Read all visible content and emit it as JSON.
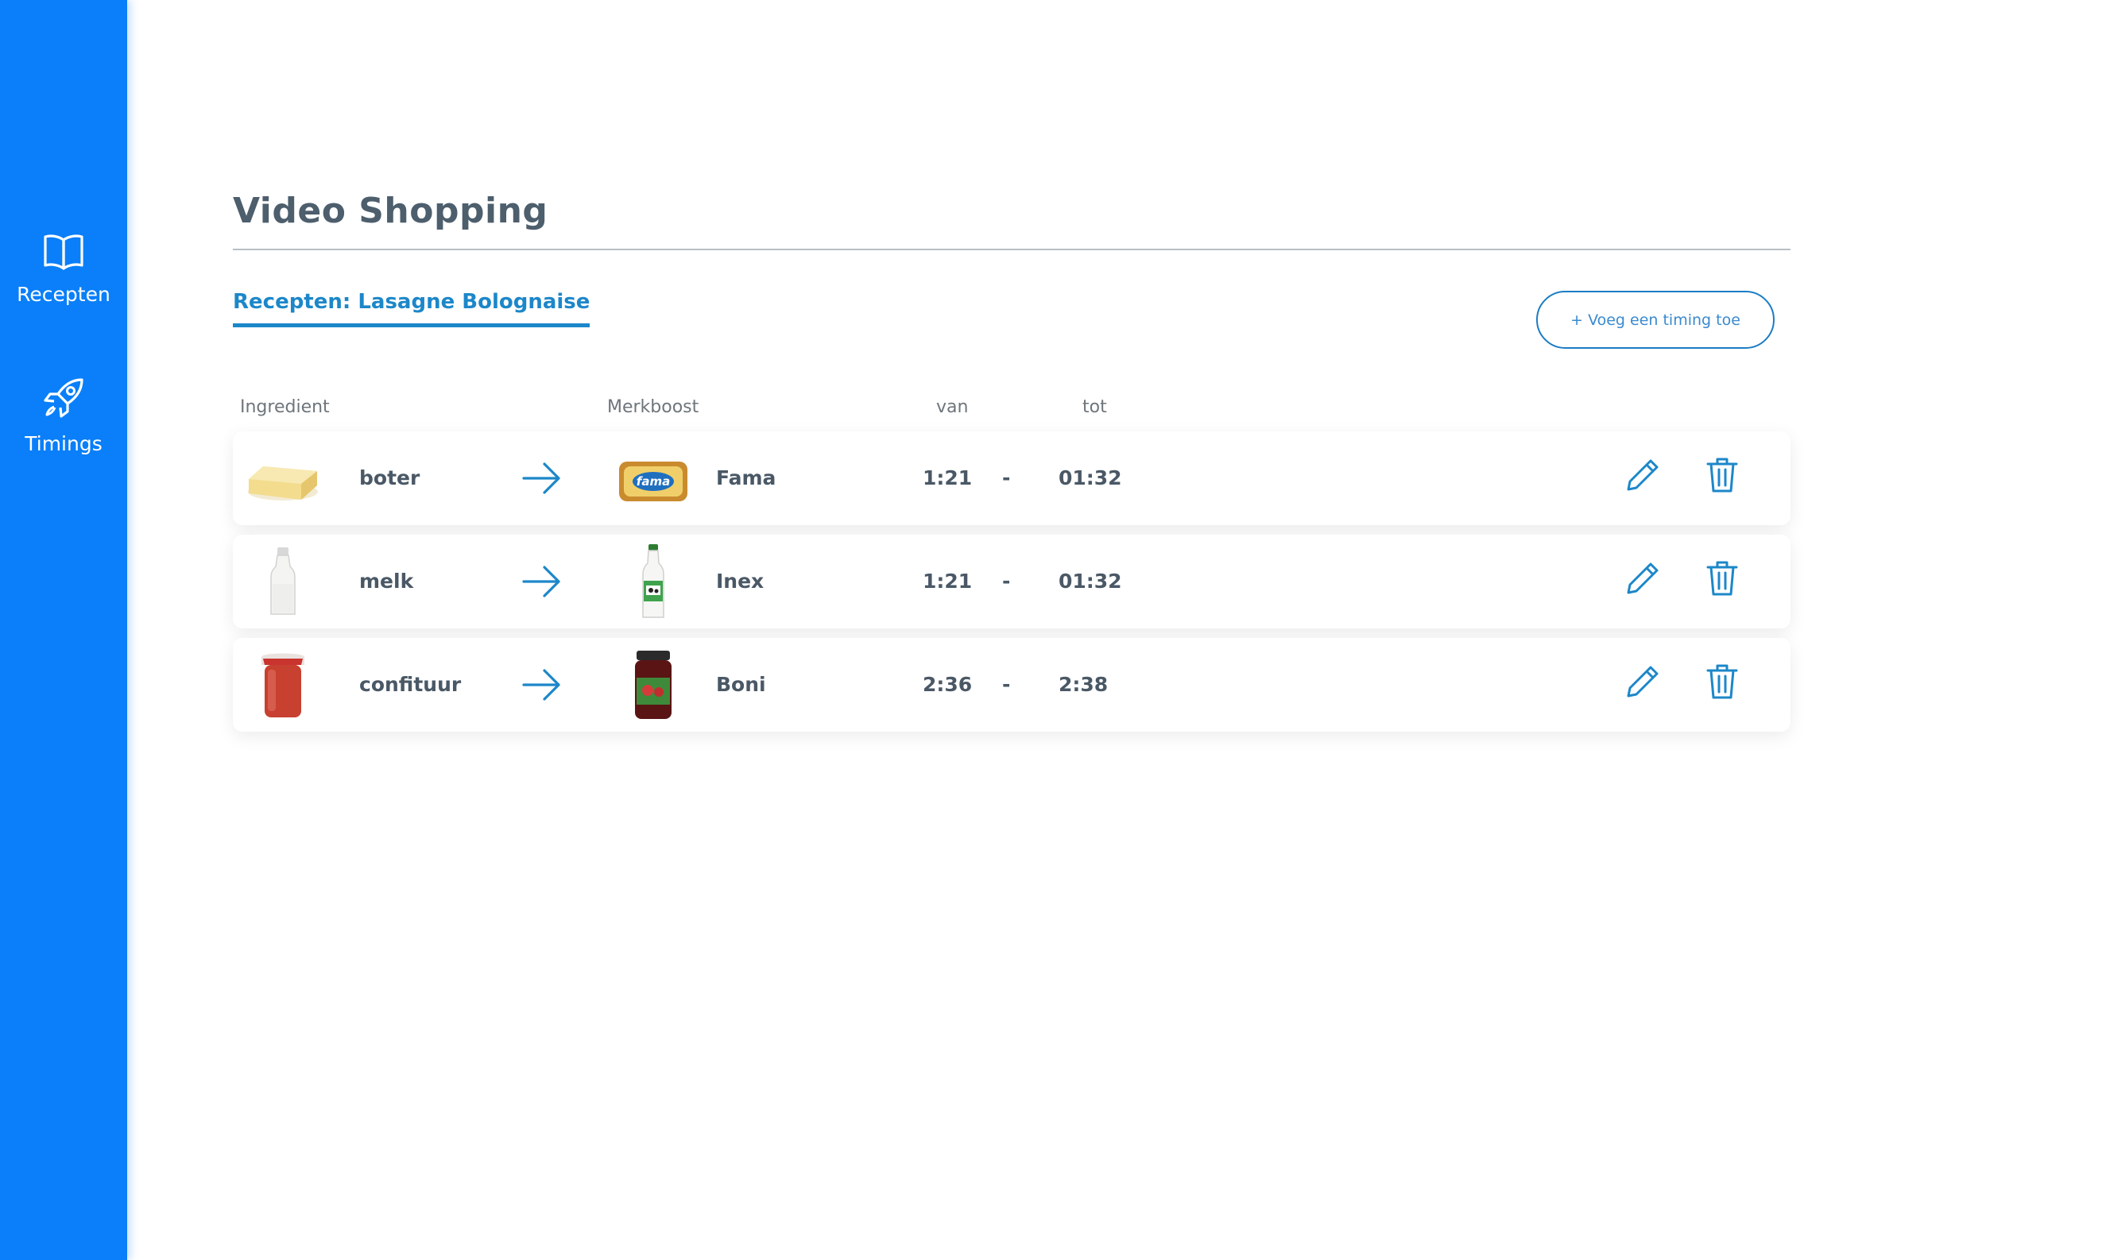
{
  "sidebar": {
    "items": [
      {
        "label": "Recepten",
        "icon": "book-icon"
      },
      {
        "label": "Timings",
        "icon": "rocket-icon"
      }
    ]
  },
  "page": {
    "title": "Video Shopping",
    "recipe_tab": "Recepten: Lasagne Bolognaise",
    "add_button": "+ Voeg een timing toe"
  },
  "table": {
    "headers": {
      "ingredient": "Ingredient",
      "merkboost": "Merkboost",
      "van": "van",
      "tot": "tot"
    },
    "rows": [
      {
        "ingredient": "boter",
        "ingredient_icon": "butter-image",
        "brand": "Fama",
        "brand_icon": "fama-tub-image",
        "van": "1:21",
        "separator": "-",
        "tot": "01:32"
      },
      {
        "ingredient": "melk",
        "ingredient_icon": "milk-bottle-image",
        "brand": "Inex",
        "brand_icon": "inex-milk-bottle-image",
        "van": "1:21",
        "separator": "-",
        "tot": "01:32"
      },
      {
        "ingredient": "confituur",
        "ingredient_icon": "jam-jar-image",
        "brand": "Boni",
        "brand_icon": "boni-jam-jar-image",
        "van": "2:36",
        "separator": "-",
        "tot": "2:38"
      }
    ]
  },
  "colors": {
    "sidebar": "#0a7ff9",
    "accent": "#1c87c9",
    "text": "#4a5866"
  }
}
